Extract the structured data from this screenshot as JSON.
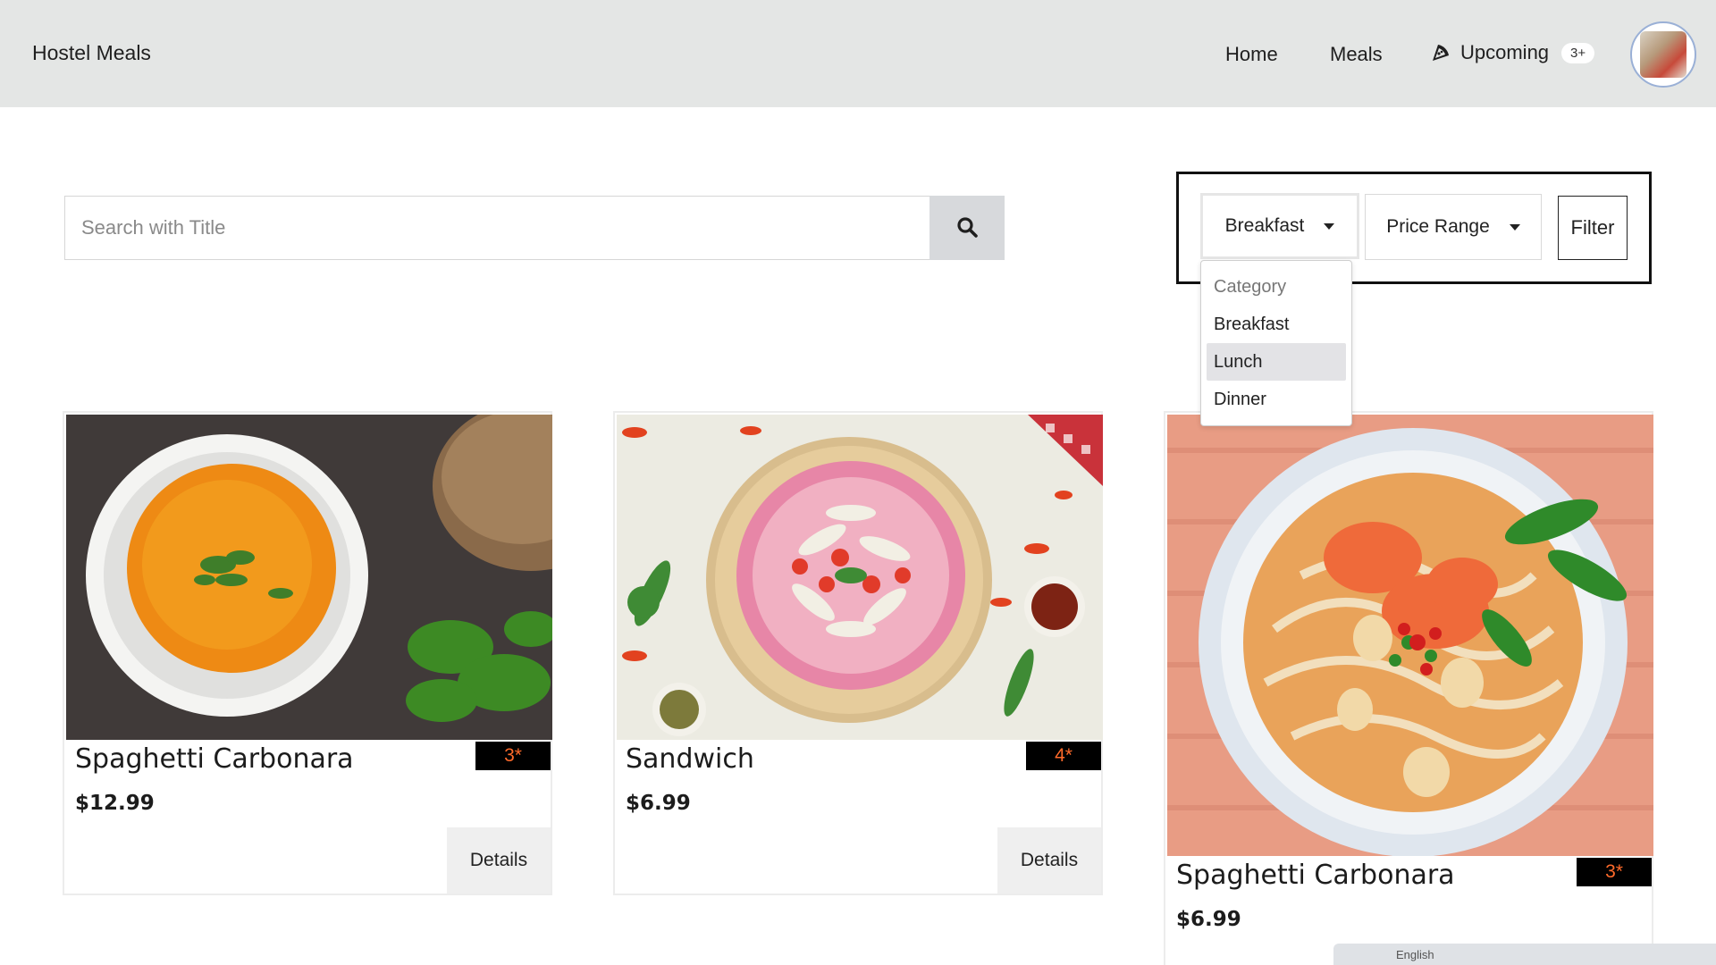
{
  "navbar": {
    "brand": "Hostel Meals",
    "links": {
      "home": "Home",
      "meals": "Meals",
      "upcoming": "Upcoming"
    },
    "upcoming_badge": "3+",
    "upcoming_icon": "pizza-slice-icon",
    "avatar_icon": "user-avatar"
  },
  "search": {
    "placeholder": "Search with Title",
    "value": "",
    "button_icon": "search-icon"
  },
  "filters": {
    "category_selected": "Breakfast",
    "price_range_label": "Price Range",
    "filter_button": "Filter",
    "category_menu": {
      "header": "Category",
      "options": [
        "Breakfast",
        "Lunch",
        "Dinner"
      ],
      "highlighted": "Lunch"
    }
  },
  "cards": [
    {
      "title": "Spaghetti Carbonara",
      "rating": "3*",
      "price": "$12.99",
      "details": "Details",
      "image": "tomato-soup-bowl"
    },
    {
      "title": "Sandwich",
      "rating": "4*",
      "price": "$6.99",
      "details": "Details",
      "image": "pizza-top-view"
    },
    {
      "title": "Spaghetti Carbonara",
      "rating": "3*",
      "price": "$6.99",
      "image": "shrimp-noodle-bowl"
    }
  ],
  "taskbar": {
    "language": "English"
  },
  "colors": {
    "navbar_bg": "#e4e6e5",
    "rating_text": "#ff6a2a",
    "rating_bg": "#000000",
    "search_btn_bg": "#d7d9dc"
  }
}
